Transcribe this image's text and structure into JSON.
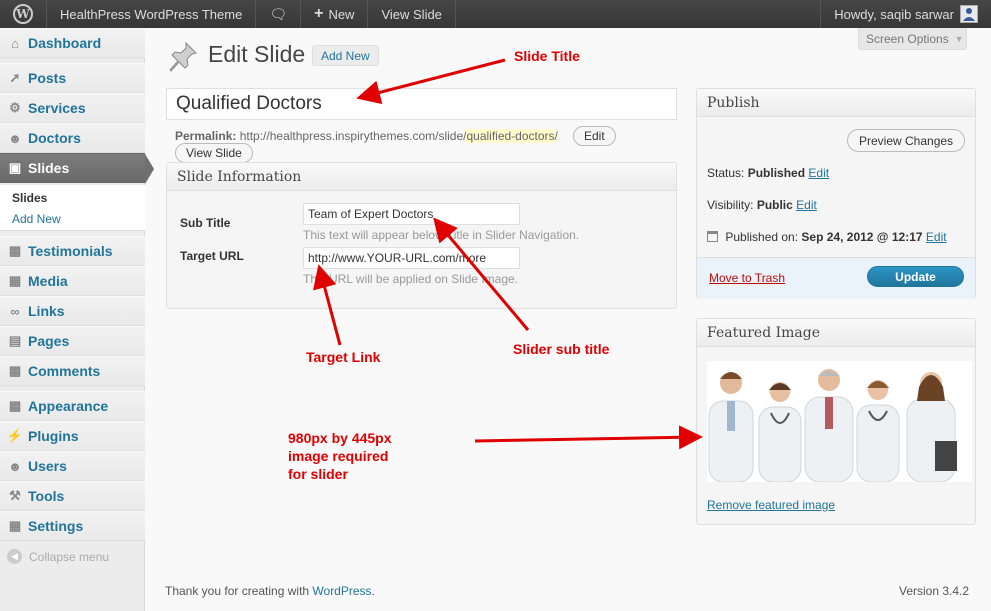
{
  "adminbar": {
    "site_name": "HealthPress WordPress Theme",
    "new_label": "New",
    "view_label": "View Slide",
    "howdy": "Howdy, saqib sarwar"
  },
  "sidebar": {
    "items": [
      {
        "label": "Dashboard",
        "icon": "dashboard-icon"
      },
      {
        "label": "Posts",
        "icon": "pin-icon"
      },
      {
        "label": "Services",
        "icon": "gear-icon"
      },
      {
        "label": "Doctors",
        "icon": "users-icon"
      },
      {
        "label": "Slides",
        "icon": "image-icon"
      },
      {
        "label": "Testimonials",
        "icon": "comment-icon"
      },
      {
        "label": "Media",
        "icon": "media-icon"
      },
      {
        "label": "Links",
        "icon": "link-icon"
      },
      {
        "label": "Pages",
        "icon": "pages-icon"
      },
      {
        "label": "Comments",
        "icon": "comment-icon"
      },
      {
        "label": "Appearance",
        "icon": "appearance-icon"
      },
      {
        "label": "Plugins",
        "icon": "plugin-icon"
      },
      {
        "label": "Users",
        "icon": "users-icon"
      },
      {
        "label": "Tools",
        "icon": "tools-icon"
      },
      {
        "label": "Settings",
        "icon": "settings-icon"
      }
    ],
    "submenu": [
      "Slides",
      "Add New"
    ],
    "collapse_label": "Collapse menu"
  },
  "main": {
    "screen_options": "Screen Options",
    "page_title": "Edit Slide",
    "add_new": "Add New",
    "title_value": "Qualified Doctors",
    "permalink_label": "Permalink:",
    "permalink_base": "http://healthpress.inspirythemes.com/slide/",
    "permalink_slug": "qualified-doctors",
    "permalink_end": "/",
    "edit_label": "Edit",
    "view_slide": "View Slide"
  },
  "slide_info": {
    "title": "Slide Information",
    "sub_title_label": "Sub Title",
    "sub_title_value": "Team of Expert Doctors",
    "sub_title_desc": "This text will appear below Title in Slider Navigation.",
    "target_url_label": "Target URL",
    "target_url_value": "http://www.YOUR-URL.com/more",
    "target_url_desc": "This URL will be applied on Slide Image."
  },
  "publish": {
    "title": "Publish",
    "preview": "Preview Changes",
    "status_label": "Status:",
    "status_value": "Published",
    "visibility_label": "Visibility:",
    "visibility_value": "Public",
    "published_label": "Published on:",
    "published_value": "Sep 24, 2012 @ 12:17",
    "edit": "Edit",
    "trash": "Move to Trash",
    "update": "Update"
  },
  "featured": {
    "title": "Featured Image",
    "remove": "Remove featured image"
  },
  "annotations": {
    "slide_title": "Slide Title",
    "target_link": "Target Link",
    "slider_sub_title": "Slider sub title",
    "image_note_1": "980px by 445px",
    "image_note_2": "image required",
    "image_note_3": "for slider"
  },
  "footer": {
    "thanks_prefix": "Thank you for creating with ",
    "wordpress": "WordPress",
    "thanks_suffix": ".",
    "version": "Version 3.4.2"
  },
  "colors": {
    "link": "#21759b",
    "annotation": "#e00000",
    "update_button": "#21759b",
    "trash": "#bc0b0b"
  }
}
